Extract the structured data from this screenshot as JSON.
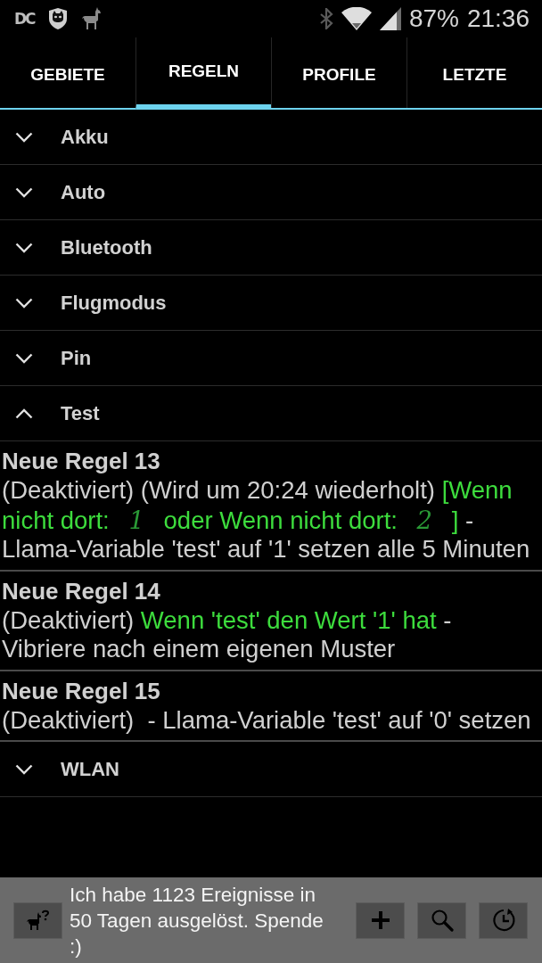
{
  "status_bar": {
    "badge": "DC",
    "battery": "87%",
    "time": "21:36"
  },
  "tabs": [
    {
      "label": "GEBIETE",
      "selected": false
    },
    {
      "label": "REGELN",
      "selected": true
    },
    {
      "label": "PROFILE",
      "selected": false
    },
    {
      "label": "LETZTE",
      "selected": false
    }
  ],
  "groups": [
    {
      "label": "Akku",
      "expanded": false
    },
    {
      "label": "Auto",
      "expanded": false
    },
    {
      "label": "Bluetooth",
      "expanded": false
    },
    {
      "label": "Flugmodus",
      "expanded": false
    },
    {
      "label": "Pin",
      "expanded": false
    },
    {
      "label": "Test",
      "expanded": true,
      "children": [
        {
          "title": "Neue Regel 13",
          "description": [
            {
              "kind": "plain",
              "text": "(Deaktiviert) (Wird um 20:24 wiederholt) "
            },
            {
              "kind": "condition",
              "text": "[Wenn nicht dort: "
            },
            {
              "kind": "scribble",
              "text": "1"
            },
            {
              "kind": "condition",
              "text": " oder Wenn nicht dort: "
            },
            {
              "kind": "scribble",
              "text": "2"
            },
            {
              "kind": "condition",
              "text": " ]"
            },
            {
              "kind": "plain",
              "text": " - Llama-Variable 'test' auf '1' setzen alle 5 Minuten"
            }
          ]
        },
        {
          "title": "Neue Regel 14",
          "description": [
            {
              "kind": "plain",
              "text": "(Deaktiviert) "
            },
            {
              "kind": "condition",
              "text": "Wenn 'test' den Wert '1' hat"
            },
            {
              "kind": "plain",
              "text": " - Vibriere nach einem eigenen Muster"
            }
          ]
        },
        {
          "title": "Neue Regel 15",
          "description": [
            {
              "kind": "plain",
              "text": "(Deaktiviert)  - Llama-Variable 'test' auf '0' setzen"
            }
          ]
        }
      ]
    },
    {
      "label": "WLAN",
      "expanded": false
    }
  ],
  "footer": {
    "message": "Ich habe 1123 Ereignisse in 50 Tagen ausgelöst. Spende :)"
  }
}
